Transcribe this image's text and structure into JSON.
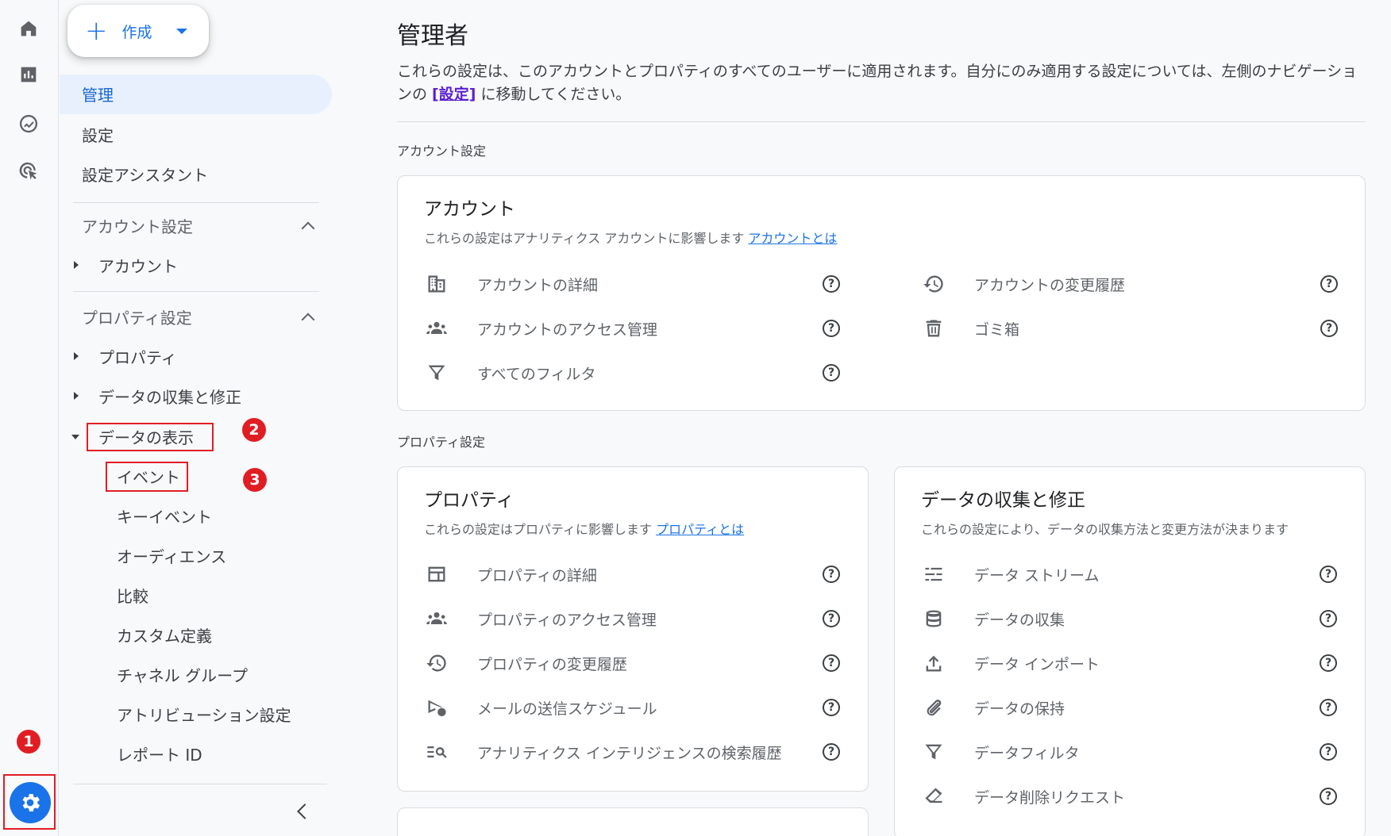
{
  "create": {
    "label": "作成"
  },
  "nav": {
    "admin": "管理",
    "settings": "設定",
    "setup_assistant": "設定アシスタント",
    "account_settings_header": "アカウント設定",
    "account": "アカウント",
    "property_settings_header": "プロパティ設定",
    "property": "プロパティ",
    "data_collection": "データの収集と修正",
    "data_display": "データの表示",
    "events": "イベント",
    "key_events": "キーイベント",
    "audiences": "オーディエンス",
    "comparisons": "比較",
    "custom_definitions": "カスタム定義",
    "channel_groups": "チャネル グループ",
    "attribution_settings": "アトリビューション設定",
    "report_id": "レポート ID"
  },
  "badges": {
    "b1": "1",
    "b2": "2",
    "b3": "3"
  },
  "main": {
    "title": "管理者",
    "desc_before": "これらの設定は、このアカウントとプロパティのすべてのユーザーに適用されます。自分にのみ適用する設定については、左側のナビゲーションの ",
    "desc_link": "[設定]",
    "desc_after": " に移動してください。",
    "account_section": "アカウント設定",
    "property_section": "プロパティ設定"
  },
  "account_card": {
    "title": "アカウント",
    "sub": "これらの設定はアナリティクス アカウントに影響します ",
    "sub_link": "アカウントとは",
    "items": [
      "アカウントの詳細",
      "アカウントのアクセス管理",
      "すべてのフィルタ",
      "アカウントの変更履歴",
      "ゴミ箱"
    ]
  },
  "property_card": {
    "title": "プロパティ",
    "sub": "これらの設定はプロパティに影響します ",
    "sub_link": "プロパティとは",
    "items": [
      "プロパティの詳細",
      "プロパティのアクセス管理",
      "プロパティの変更履歴",
      "メールの送信スケジュール",
      "アナリティクス インテリジェンスの検索履歴"
    ]
  },
  "data_card": {
    "title": "データの収集と修正",
    "sub": "これらの設定により、データの収集方法と変更方法が決まります",
    "items": [
      "データ ストリーム",
      "データの収集",
      "データ インポート",
      "データの保持",
      "データフィルタ",
      "データ削除リクエスト"
    ]
  },
  "help_glyph": "?",
  "colors": {
    "accent": "#1a73e8",
    "active_bg": "#e8f0fe",
    "annotation": "#e11d24"
  }
}
